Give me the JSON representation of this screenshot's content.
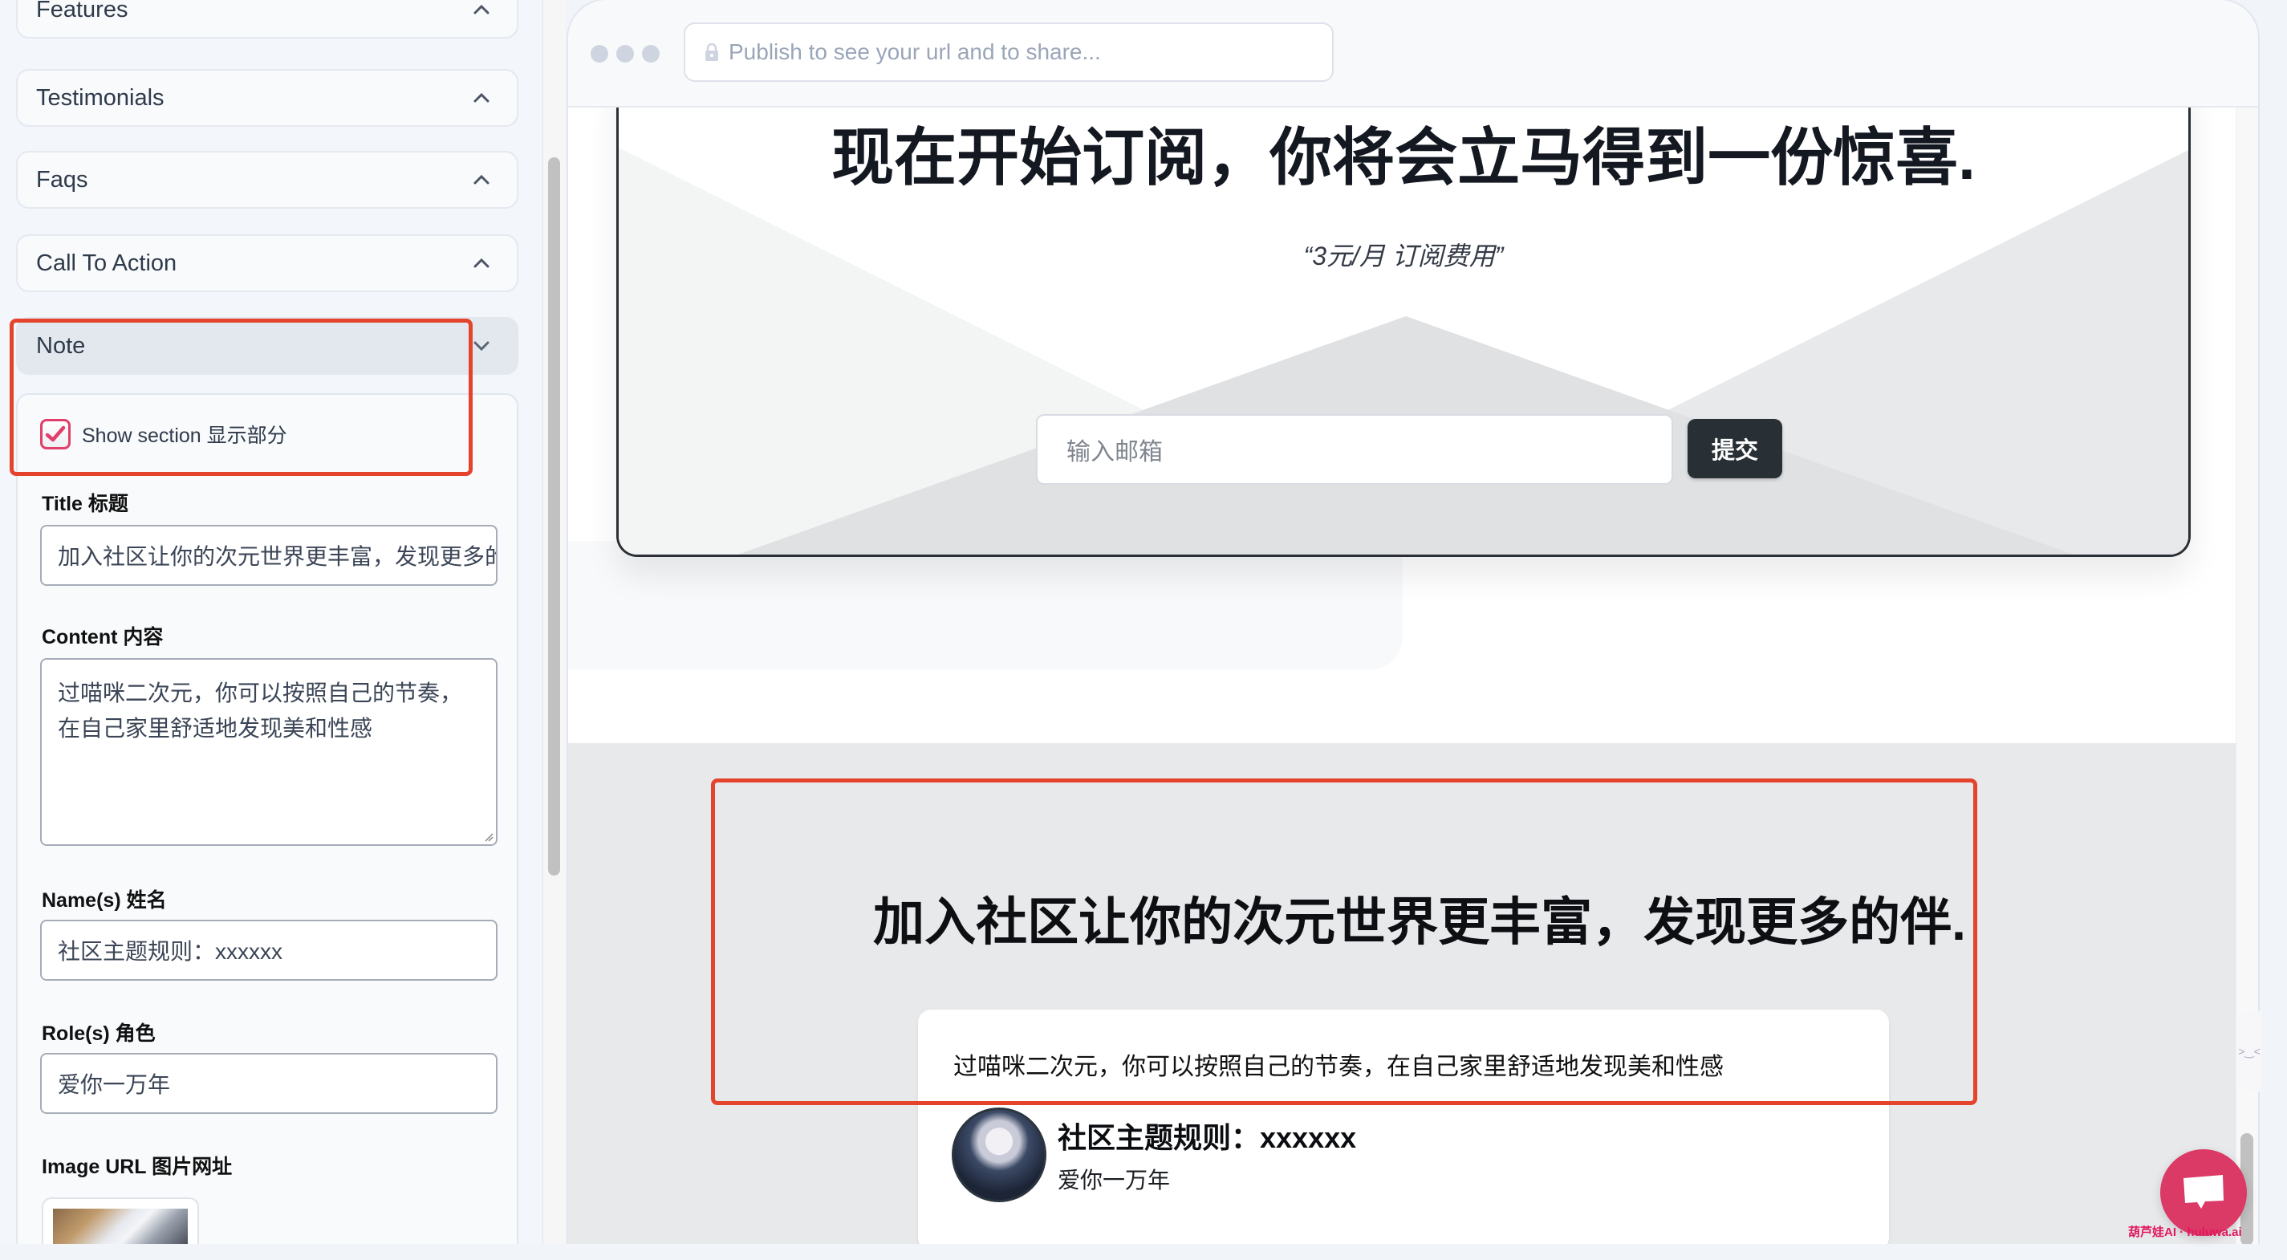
{
  "sidebar": {
    "sections": [
      {
        "label": "Features",
        "state": "collapsed"
      },
      {
        "label": "Testimonials",
        "state": "collapsed"
      },
      {
        "label": "Faqs",
        "state": "collapsed"
      },
      {
        "label": "Call To Action",
        "state": "collapsed"
      },
      {
        "label": "Note",
        "state": "expanded"
      }
    ],
    "note_panel": {
      "show_section_label": "Show section 显示部分",
      "show_section_checked": true,
      "title_label": "Title 标题",
      "title_value": "加入社区让你的次元世界更丰富，发现更多的伴.",
      "content_label": "Content 内容",
      "content_value": "过喵咪二次元，你可以按照自己的节奏，在自己家里舒适地发现美和性感",
      "names_label": "Name(s) 姓名",
      "names_value": "社区主题规则：xxxxxx",
      "roles_label": "Role(s) 角色",
      "roles_value": "爱你一万年",
      "image_url_label": "Image URL 图片网址"
    }
  },
  "preview": {
    "url_placeholder": "Publish to see your url and to share...",
    "subscribe": {
      "title": "现在开始订阅，你将会立马得到一份惊喜.",
      "price_note": "“3元/月 订阅费用”",
      "email_placeholder": "输入邮箱",
      "submit_label": "提交"
    },
    "note": {
      "title": "加入社区让你的次元世界更丰富，发现更多的伴.",
      "content": "过喵咪二次元，你可以按照自己的节奏，在自己家里舒适地发现美和性感",
      "author_name": "社区主题规则：xxxxxx",
      "author_role": "爱你一万年"
    }
  },
  "widget": {
    "watermark": "葫芦娃AI  ·  huluwa.ai",
    "side_peek": ">‿<"
  },
  "colors": {
    "annotation": "#e5442c",
    "checkbox": "#e0406a",
    "chat_button": "#db3966",
    "submit_button": "#293035"
  }
}
